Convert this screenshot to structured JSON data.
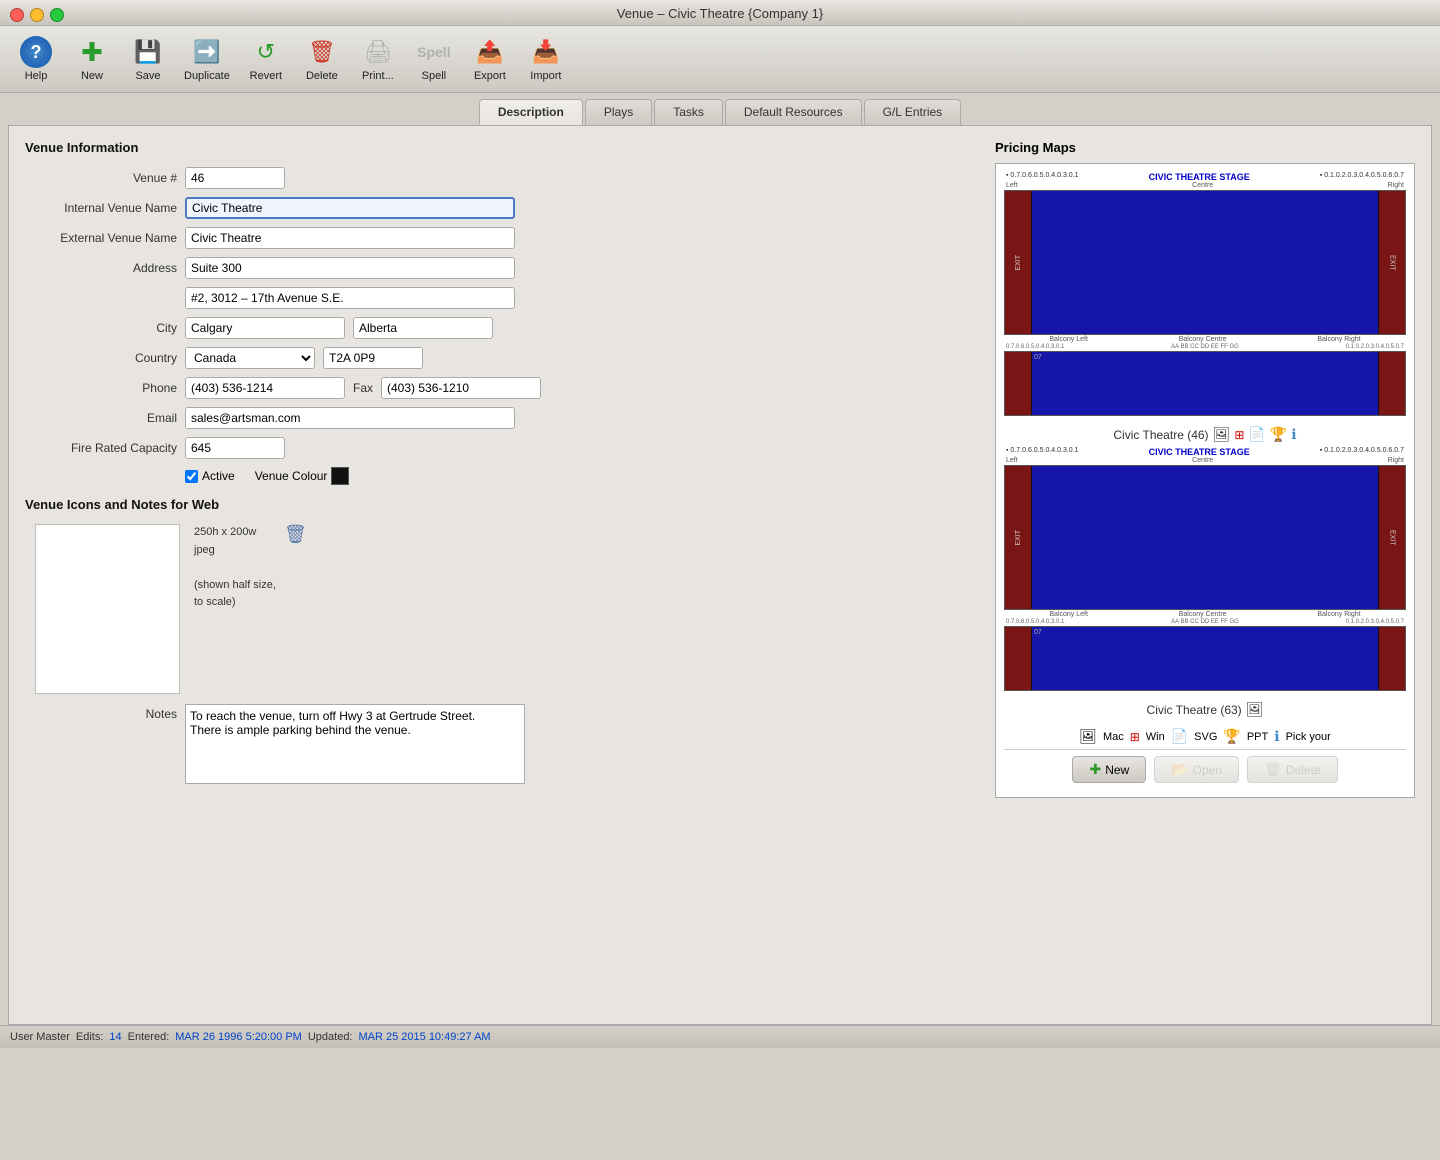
{
  "window": {
    "title": "Venue – Civic Theatre {Company 1}",
    "buttons": [
      "close",
      "minimize",
      "maximize"
    ]
  },
  "toolbar": {
    "buttons": [
      {
        "id": "help",
        "label": "Help",
        "icon": "?",
        "icon_class": "icon-help"
      },
      {
        "id": "new",
        "label": "New",
        "icon": "+",
        "icon_class": "icon-new"
      },
      {
        "id": "save",
        "label": "Save",
        "icon": "💾",
        "icon_class": "icon-save"
      },
      {
        "id": "duplicate",
        "label": "Duplicate",
        "icon": "➡",
        "icon_class": "icon-duplicate"
      },
      {
        "id": "revert",
        "label": "Revert",
        "icon": "↺",
        "icon_class": "icon-revert"
      },
      {
        "id": "delete",
        "label": "Delete",
        "icon": "🗑",
        "icon_class": "icon-delete"
      },
      {
        "id": "print",
        "label": "Print...",
        "icon": "🖨",
        "icon_class": "icon-print"
      },
      {
        "id": "spell",
        "label": "Spell",
        "icon": "Sp",
        "icon_class": "icon-spell"
      },
      {
        "id": "export",
        "label": "Export",
        "icon": "➡",
        "icon_class": "icon-export"
      },
      {
        "id": "import",
        "label": "Import",
        "icon": "➡",
        "icon_class": "icon-import"
      }
    ]
  },
  "tabs": [
    {
      "id": "description",
      "label": "Description",
      "active": true
    },
    {
      "id": "plays",
      "label": "Plays"
    },
    {
      "id": "tasks",
      "label": "Tasks"
    },
    {
      "id": "default-resources",
      "label": "Default Resources"
    },
    {
      "id": "gl-entries",
      "label": "G/L Entries"
    }
  ],
  "venue_info": {
    "section_title": "Venue Information",
    "fields": {
      "venue_number_label": "Venue #",
      "venue_number": "46",
      "internal_venue_name_label": "Internal Venue Name",
      "internal_venue_name": "Civic Theatre",
      "external_venue_name_label": "External Venue Name",
      "external_venue_name": "Civic Theatre",
      "address_label": "Address",
      "address1": "Suite 300",
      "address2": "#2, 3012 – 17th Avenue S.E.",
      "city_label": "City",
      "city": "Calgary",
      "province": "Alberta",
      "country_label": "Country",
      "country": "Canada",
      "postal": "T2A 0P9",
      "phone_label": "Phone",
      "phone": "(403) 536-1214",
      "fax_label": "Fax",
      "fax": "(403) 536-1210",
      "email_label": "Email",
      "email": "sales@artsman.com",
      "fire_rated_label": "Fire Rated Capacity",
      "fire_rated": "645",
      "active_label": "Active",
      "active_checked": true,
      "venue_colour_label": "Venue Colour"
    }
  },
  "web_section": {
    "title": "Venue Icons and Notes for Web",
    "image_meta": "250h x 200w\njpeg\n\n(shown half size,\nto scale)",
    "notes_label": "Notes",
    "notes": "To reach the venue, turn off Hwy 3 at Gertrude Street.\nThere is ample parking behind the venue."
  },
  "pricing_maps": {
    "title": "Pricing Maps",
    "maps": [
      {
        "name": "Civic Theatre (46)",
        "stage_title": "CIVIC THEATRE STAGE",
        "left_label": "Left",
        "centre_label": "Centre",
        "right_label": "Right",
        "balcony_left": "Balcony Left",
        "balcony_centre": "Balcony Centre",
        "balcony_right": "Balcony Right"
      },
      {
        "name": "Civic Theatre (63)",
        "stage_title": "CIVIC THEATRE STAGE",
        "left_label": "Left",
        "centre_label": "Centre",
        "right_label": "Right",
        "balcony_left": "Balcony Left",
        "balcony_centre": "Balcony Centre",
        "balcony_right": "Balcony Right"
      }
    ],
    "icon_bar": {
      "mac_label": "Mac",
      "win_label": "Win",
      "svg_label": "SVG",
      "ppt_label": "PPT",
      "pick_label": "Pick your"
    },
    "buttons": {
      "new_label": "New",
      "open_label": "Open",
      "delete_label": "Delete"
    }
  },
  "status_bar": {
    "user_label": "User Master",
    "edits_label": "Edits:",
    "edits_count": "14",
    "entered_label": "Entered:",
    "entered_date": "MAR 26 1996 5:20:00 PM",
    "updated_label": "Updated:",
    "updated_date": "MAR 25 2015 10:49:27 AM"
  }
}
